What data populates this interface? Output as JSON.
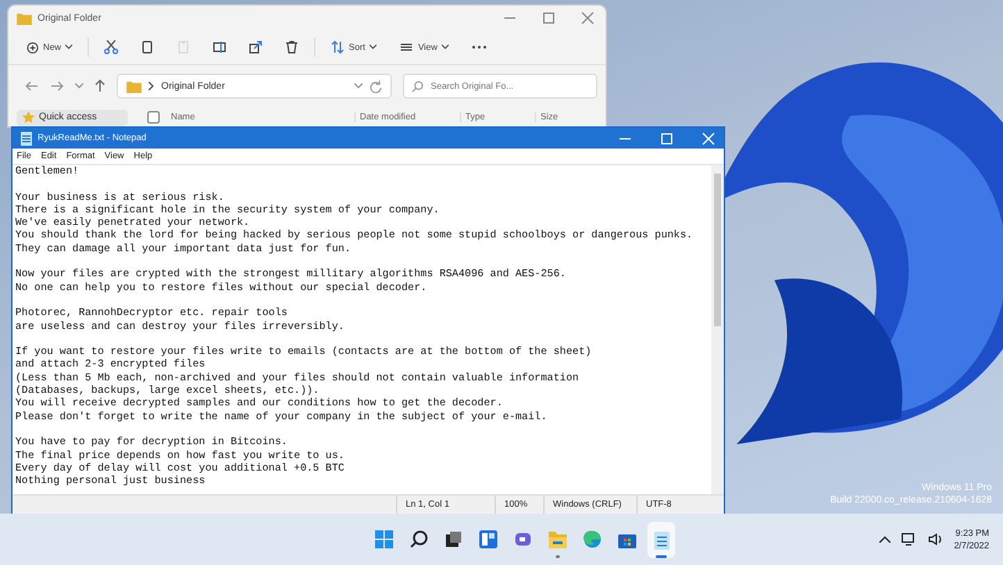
{
  "explorer": {
    "title": "Original Folder",
    "toolbar": [
      {
        "kind": "new",
        "label": "New",
        "disabled": false
      },
      {
        "kind": "cut",
        "disabled": false
      },
      {
        "kind": "copy",
        "disabled": false
      },
      {
        "kind": "paste",
        "disabled": true
      },
      {
        "kind": "rename",
        "disabled": false
      },
      {
        "kind": "share",
        "disabled": false
      },
      {
        "kind": "delete",
        "disabled": false
      },
      {
        "kind": "sort",
        "label": "Sort",
        "disabled": false
      },
      {
        "kind": "view",
        "label": "View",
        "disabled": false
      },
      {
        "kind": "more",
        "disabled": false
      }
    ],
    "address": "Original Folder",
    "search": {
      "placeholder": "Search Original Fo..."
    },
    "sidebar": {
      "items": [
        {
          "label": "Quick access"
        }
      ]
    },
    "select_all_checked": false,
    "columns": [
      "Name",
      "Date modified",
      "Type",
      "Size"
    ]
  },
  "notepad": {
    "title": "RyukReadMe.txt - Notepad",
    "menu": [
      "File",
      "Edit",
      "Format",
      "View",
      "Help"
    ],
    "text": "Gentlemen!\n\nYour business is at serious risk.\nThere is a significant hole in the security system of your company.\nWe've easily penetrated your network.\nYou should thank the lord for being hacked by serious people not some stupid schoolboys or dangerous punks.\nThey can damage all your important data just for fun.\n\nNow your files are crypted with the strongest millitary algorithms RSA4096 and AES-256.\nNo one can help you to restore files without our special decoder.\n\nPhotorec, RannohDecryptor etc. repair tools\nare useless and can destroy your files irreversibly.\n\nIf you want to restore your files write to emails (contacts are at the bottom of the sheet)\nand attach 2-3 encrypted files\n(Less than 5 Mb each, non-archived and your files should not contain valuable information\n(Databases, backups, large excel sheets, etc.)).\nYou will receive decrypted samples and our conditions how to get the decoder.\nPlease don't forget to write the name of your company in the subject of your e-mail.\n\nYou have to pay for decryption in Bitcoins.\nThe final price depends on how fast you write to us.\nEvery day of delay will cost you additional +0.5 BTC\nNothing personal just business",
    "status_bar": [
      "Ln 1, Col 1",
      "100%",
      "Windows (CRLF)",
      "UTF-8"
    ]
  },
  "desktop": {
    "edition": "Windows 11 Pro",
    "build": "Build 22000.co_release.210604-1628"
  },
  "taskbar": {
    "apps": [
      {
        "kind": "start",
        "running": false,
        "active": false
      },
      {
        "kind": "search",
        "running": false,
        "active": false
      },
      {
        "kind": "taskview",
        "running": false,
        "active": false
      },
      {
        "kind": "widgets",
        "running": false,
        "active": false
      },
      {
        "kind": "chat",
        "running": false,
        "active": false
      },
      {
        "kind": "explorer",
        "running": true,
        "active": false
      },
      {
        "kind": "edge",
        "running": false,
        "active": false
      },
      {
        "kind": "store",
        "running": false,
        "active": false
      },
      {
        "kind": "notepad",
        "running": true,
        "active": true
      }
    ],
    "time": "9:23 PM",
    "date": "2/7/2022"
  }
}
